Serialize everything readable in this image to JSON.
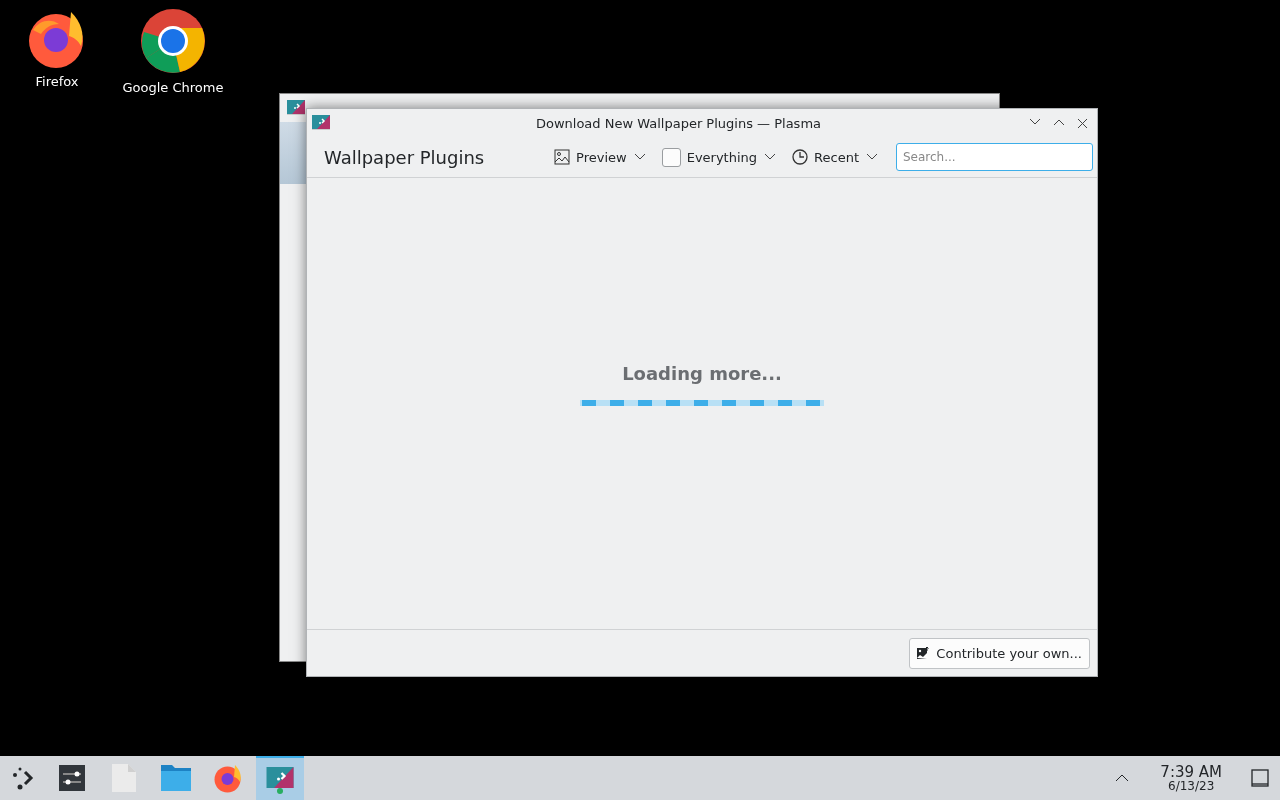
{
  "desktop_icons": [
    {
      "label": "Firefox"
    },
    {
      "label": "Google Chrome"
    }
  ],
  "window": {
    "title": "Download New Wallpaper Plugins — Plasma",
    "heading": "Wallpaper Plugins",
    "filters": [
      {
        "kind": "icon",
        "label": "Preview"
      },
      {
        "kind": "checkbox",
        "label": "Everything",
        "checked": false
      },
      {
        "kind": "clock",
        "label": "Recent"
      }
    ],
    "search": {
      "placeholder": "Search..."
    },
    "status": "Loading more...",
    "contribute_button": "Contribute your own..."
  },
  "taskbar": {
    "tasks": [
      {
        "selected": false
      },
      {
        "selected": false
      },
      {
        "selected": false
      },
      {
        "selected": false
      },
      {
        "selected": true
      }
    ],
    "time": "7:39 AM",
    "date": "6/13/23"
  }
}
